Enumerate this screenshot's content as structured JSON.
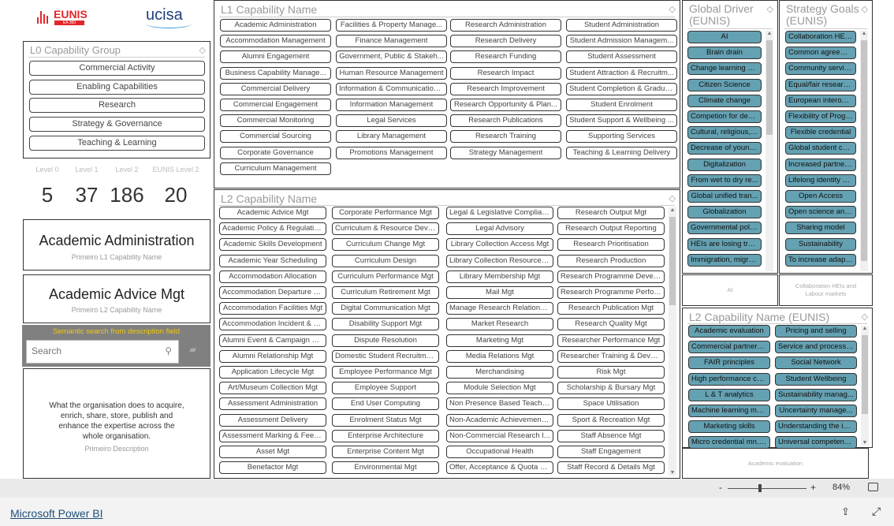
{
  "logos": {
    "eunis": "EUNIS",
    "eunis_sub": "EA 360",
    "ucisa": "ucisa"
  },
  "l0": {
    "title": "L0 Capability Group",
    "items": [
      "Commercial Activity",
      "Enabling Capabilities",
      "Research",
      "Strategy & Governance",
      "Teaching & Learning"
    ]
  },
  "stats": [
    {
      "label": "Level 0",
      "value": "5"
    },
    {
      "label": "Level 1",
      "value": "37"
    },
    {
      "label": "Level 2",
      "value": "186"
    },
    {
      "label": "EUNIS Level 2",
      "value": "20"
    }
  ],
  "card_l1": {
    "value": "Academic Administration",
    "label": "Primeiro L1 Capability Name"
  },
  "card_l2": {
    "value": "Academic Advice Mgt",
    "label": "Primeiro L2 Capability Name"
  },
  "search": {
    "label": "Semantic search from description field",
    "placeholder": "Search"
  },
  "description": {
    "text": "What the organisation does to acquire, enrich, share, store, publish and enhance the expertise across the whole organisation.",
    "label": "Primeiro Description"
  },
  "l1": {
    "title": "L1 Capability Name",
    "items": [
      "Academic Administration",
      "Facilities & Property Manage...",
      "Research Administration",
      "Student Administration",
      "Accommodation Management",
      "Finance Management",
      "Research Delivery",
      "Student Admission Managem...",
      "Alumni Engagement",
      "Government, Public & Stakeh...",
      "Research Funding",
      "Student Assessment",
      "Business Capability Manage...",
      "Human Resource Management",
      "Research Impact",
      "Student Attraction & Recruitm...",
      "Commercial Delivery",
      "Information & Communication...",
      "Research Improvement",
      "Student Completion & Gradua...",
      "Commercial Engagement",
      "Information Management",
      "Research Opportunity & Plan...",
      "Student Enrolment",
      "Commercial Monitoring",
      "Legal Services",
      "Research Publications",
      "Student Support & Wellbeing ...",
      "Commercial Sourcing",
      "Library Management",
      "Research Training",
      "Supporting Services",
      "Corporate Governance",
      "Promotions Management",
      "Strategy Management",
      "Teaching & Learning Delivery",
      "Curriculum Management"
    ]
  },
  "l2": {
    "title": "L2 Capability Name",
    "items": [
      "Academic Advice Mgt",
      "Corporate Performance Mgt",
      "Legal & Legislative Compliance",
      "Research Output Mgt",
      "Academic Policy & Regulation...",
      "Curriculum & Resource Devel...",
      "Legal Advisory",
      "Research Output Reporting",
      "Academic Skills Development",
      "Curriculum Change Mgt",
      "Library Collection Access Mgt",
      "Research Prioritisation",
      "Academic Year Scheduling",
      "Curriculum Design",
      "Library Collection Resource Mgt",
      "Research Production",
      "Accommodation Allocation",
      "Curriculum Performance Mgt",
      "Library Membership Mgt",
      "Research Programme Develo...",
      "Accommodation Departure & ...",
      "Curriculum Retirement Mgt",
      "Mail Mgt",
      "Research Programme Perfor...",
      "Accommodation Facilities Mgt",
      "Digital Communication Mgt",
      "Manage Research Relationshi...",
      "Research Publication Mgt",
      "Accommodation Incident & E...",
      "Disability Support Mgt",
      "Market Research",
      "Research Quality Mgt",
      "Alumni Event & Campaign Mgt",
      "Dispute Resolution",
      "Marketing Mgt",
      "Researcher Performance Mgt",
      "Alumni Relationship Mgt",
      "Domestic Student Recruitment",
      "Media Relations Mgt",
      "Researcher Training & Develo...",
      "Application Lifecycle Mgt",
      "Employee Performance Mgt",
      "Merchandising",
      "Risk Mgt",
      "Art/Museum Collection Mgt",
      "Employee Support",
      "Module Selection Mgt",
      "Scholarship & Bursary Mgt",
      "Assessment Administration",
      "End User Computing",
      "Non Presence Based Teaching",
      "Space Utilisation",
      "Assessment Delivery",
      "Enrolment Status Mgt",
      "Non-Academic Achievement ...",
      "Sport & Recreation Mgt",
      "Assessment Marking & Feedb...",
      "Enterprise Architecture",
      "Non-Commercial Research I...",
      "Staff Absence Mgt",
      "Asset Mgt",
      "Enterprise Content Mgt",
      "Occupational Health",
      "Staff Engagement",
      "Benefactor Mgt",
      "Environmental Mgt",
      "Offer, Acceptance & Quota Mgt",
      "Staff Record & Details Mgt"
    ]
  },
  "global_driver": {
    "title": "Global Driver (EUNIS)",
    "items": [
      "AI",
      "Brain drain",
      "Change learning pr...",
      "Citizen Science",
      "Climate change",
      "Competion for decr...",
      "Cultural, religious, ...",
      "Decrease of young...",
      "Digitalization",
      "From wet to dry re...",
      "Global unified tran...",
      "Globalization",
      "Governmental polit...",
      "HEIs are losing tru...",
      "Immigration, migra..."
    ],
    "card": "AI"
  },
  "strategy_goals": {
    "title": "Strategy Goals (EUNIS)",
    "items": [
      "Collaboration HEIs...",
      "Common agreeme...",
      "Community services",
      "Equal/fair researc...",
      "European interope...",
      "Flexibility of Progr...",
      "Flexible credential",
      "Global student card",
      "Increased partners...",
      "Lifelong identity or...",
      "Open Access",
      "Open science and ...",
      "Sharing model",
      "Sustainability",
      "To increase adapt..."
    ],
    "card": "Collaboration HEIs and Labour markets"
  },
  "l2_eunis": {
    "title": "L2 Capability Name (EUNIS)",
    "items": [
      "Academic evaluation",
      "Pricing and selling",
      "Commercial partners...",
      "Service and process ...",
      "FAIR principles",
      "Social Network",
      "High performance co...",
      "Student Wellbeing",
      "L & T analytics",
      "Sustainability manag...",
      "Machine learning ma...",
      "Uncertainty manage...",
      "Marketing skills",
      "Understanding the infl...",
      "Micro credential mn. ...",
      "Universal competenc..."
    ],
    "card": "Academic evaluation"
  },
  "footer": {
    "zoom": "84%",
    "minus": "-",
    "plus": "+",
    "brand": "Microsoft Power BI"
  },
  "colors": {
    "slicer_selected": "#64a1b2",
    "search_bg": "#808080",
    "search_label": "#f2c80f",
    "eunis_red": "#e2262b",
    "ucisa_blue": "#1e3f7a"
  }
}
